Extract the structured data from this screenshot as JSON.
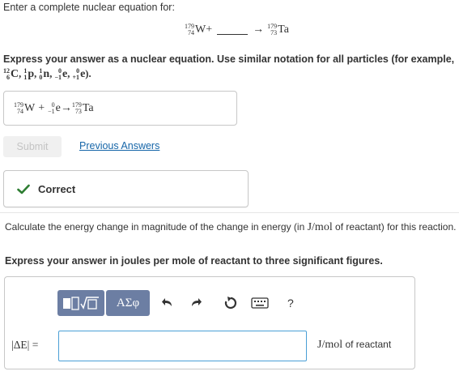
{
  "prompt": {
    "intro": "Enter a complete nuclear equation for:",
    "eq": {
      "reactant": {
        "mass": "179",
        "atomic": "74",
        "symbol": "W"
      },
      "plus": "+",
      "arrow": "→",
      "product": {
        "mass": "179",
        "atomic": "73",
        "symbol": "Ta"
      }
    }
  },
  "instruction": {
    "text": "Express your answer as a nuclear equation. Use similar notation for all particles (for example,",
    "examples": [
      {
        "mass": "12",
        "atomic": "6",
        "symbol": "C"
      },
      {
        "mass": "1",
        "atomic": "1",
        "symbol": "p"
      },
      {
        "mass": "1",
        "atomic": "0",
        "symbol": "n"
      },
      {
        "mass": "0",
        "atomic": "−1",
        "symbol": "e"
      },
      {
        "mass": "0",
        "atomic": "+1",
        "symbol": "e"
      }
    ],
    "close": ")."
  },
  "answer1": {
    "w": {
      "mass": "179",
      "atomic": "74",
      "symbol": "W"
    },
    "plus": "+",
    "e": {
      "mass": "0",
      "atomic": "−1",
      "symbol": "e"
    },
    "arrow": "→",
    "ta": {
      "mass": "179",
      "atomic": "73",
      "symbol": "Ta"
    }
  },
  "actions": {
    "submit": "Submit",
    "previous": "Previous Answers"
  },
  "feedback": {
    "correct": "Correct"
  },
  "part2": {
    "question_pre": "Calculate the energy change in magnitude of the change in energy (in ",
    "unit": "J/mol",
    "question_post": " of reactant) for this reaction.",
    "instruction": "Express your answer in joules per mole of reactant to three significant figures."
  },
  "toolbar": {
    "sigma": "ΑΣφ",
    "help": "?"
  },
  "input": {
    "label": "|ΔE| =",
    "value": "",
    "unit_serif": "J/mol",
    "unit_text": " of reactant"
  },
  "colors": {
    "link": "#1565a8",
    "check": "#2e7d32",
    "toolbar": "#6c7ea3",
    "field_border": "#4a9fd6"
  }
}
